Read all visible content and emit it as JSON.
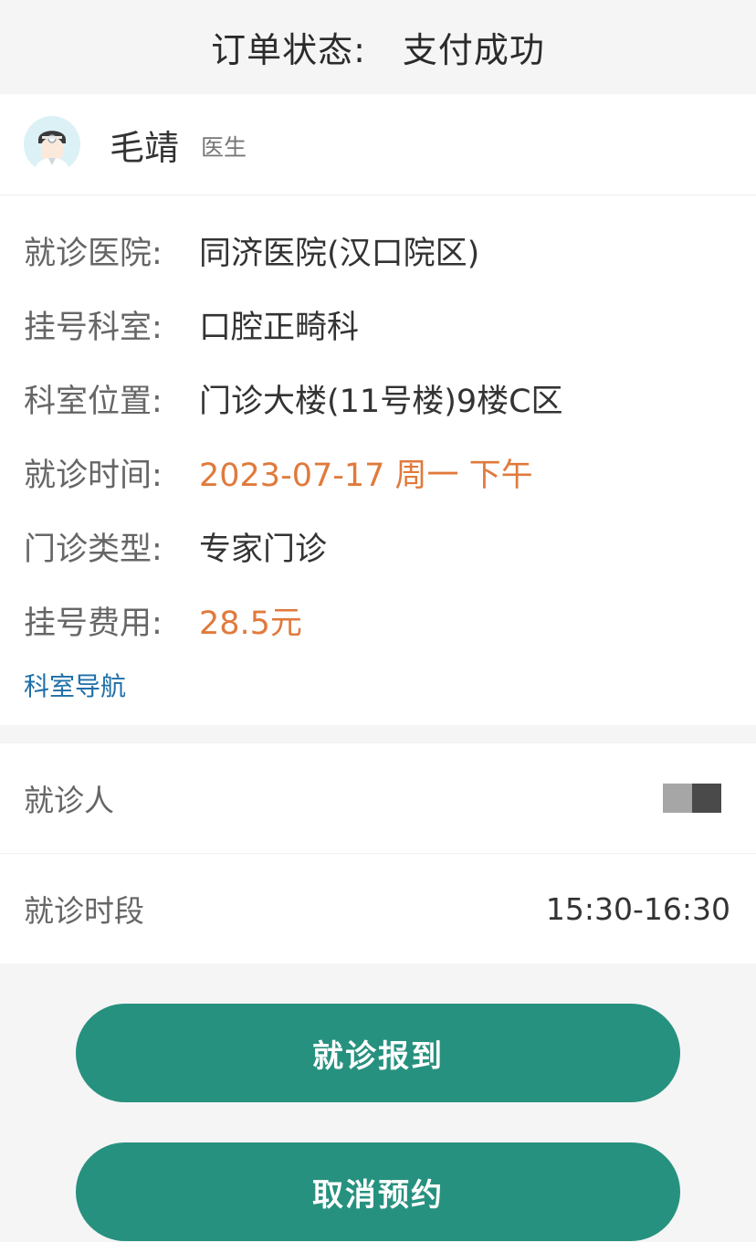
{
  "header": {
    "label": "订单状态:",
    "status": "支付成功"
  },
  "doctor": {
    "name": "毛靖",
    "title": "医生",
    "avatar_icon": "doctor-avatar-icon"
  },
  "info": [
    {
      "label": "就诊医院:",
      "value": "同济医院(汉口院区)",
      "accent": false
    },
    {
      "label": "挂号科室:",
      "value": "口腔正畸科",
      "accent": false
    },
    {
      "label": "科室位置:",
      "value": "门诊大楼(11号楼)9楼C区",
      "accent": false
    },
    {
      "label": "就诊时间:",
      "value": "2023-07-17 周一 下午",
      "accent": true
    },
    {
      "label": "门诊类型:",
      "value": "专家门诊",
      "accent": false
    },
    {
      "label": "挂号费用:",
      "value": "28.5元",
      "accent": true
    }
  ],
  "nav_link": "科室导航",
  "patient": {
    "label": "就诊人",
    "value_icon": "redacted-name-mosaic"
  },
  "period": {
    "label": "就诊时段",
    "value": "15:30-16:30"
  },
  "buttons": {
    "checkin": "就诊报到",
    "cancel": "取消预约"
  },
  "colors": {
    "accent": "#e07a3c",
    "link": "#1e6fa8",
    "button": "#27917f"
  }
}
